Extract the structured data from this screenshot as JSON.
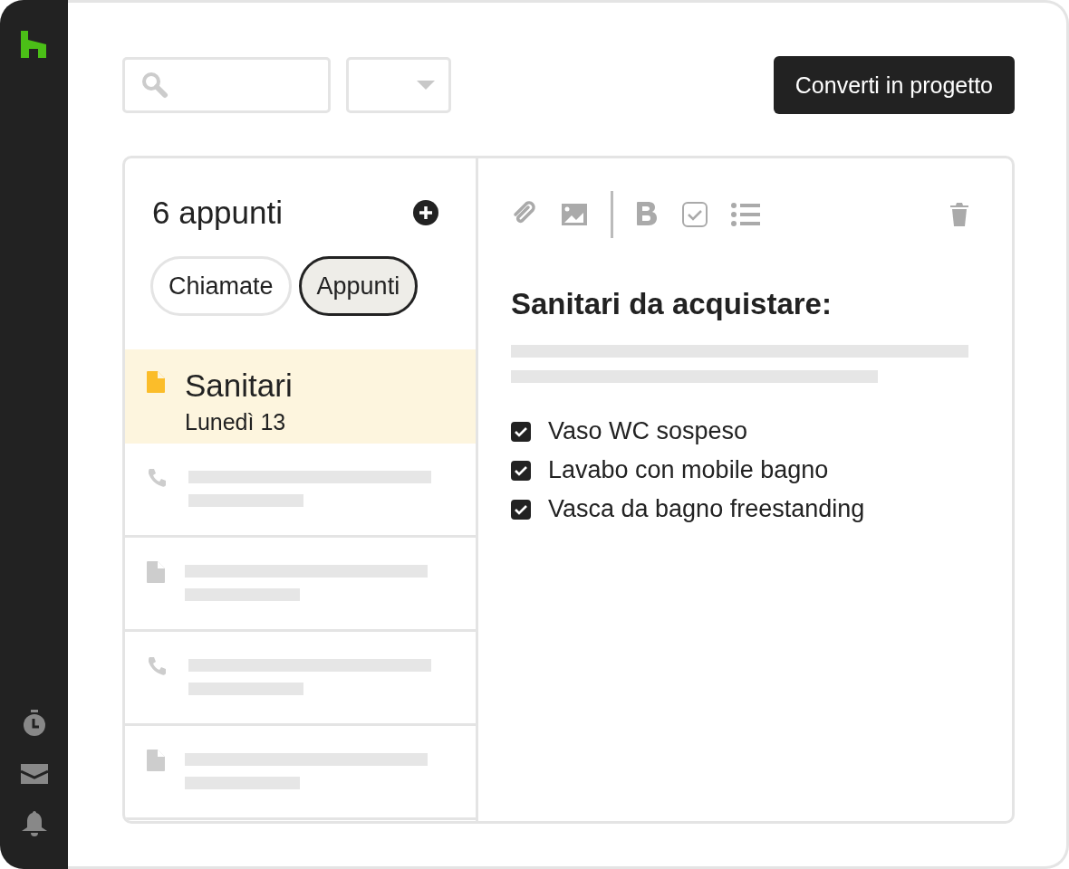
{
  "toolbar": {
    "convert_button": "Converti in progetto"
  },
  "notes_panel": {
    "title": "6 appunti",
    "filters": [
      {
        "label": "Chiamate",
        "selected": false
      },
      {
        "label": "Appunti",
        "selected": true
      }
    ],
    "items": [
      {
        "kind": "note",
        "title": "Sanitari",
        "date": "Lunedì 13",
        "selected": true
      },
      {
        "kind": "call",
        "selected": false
      },
      {
        "kind": "note",
        "selected": false
      },
      {
        "kind": "call",
        "selected": false
      },
      {
        "kind": "note",
        "selected": false
      }
    ]
  },
  "editor": {
    "title": "Sanitari da acquistare:",
    "checklist": [
      {
        "label": "Vaso WC sospeso",
        "checked": true
      },
      {
        "label": "Lavabo con mobile bagno",
        "checked": true
      },
      {
        "label": "Vasca da bagno freestanding",
        "checked": true
      }
    ]
  }
}
